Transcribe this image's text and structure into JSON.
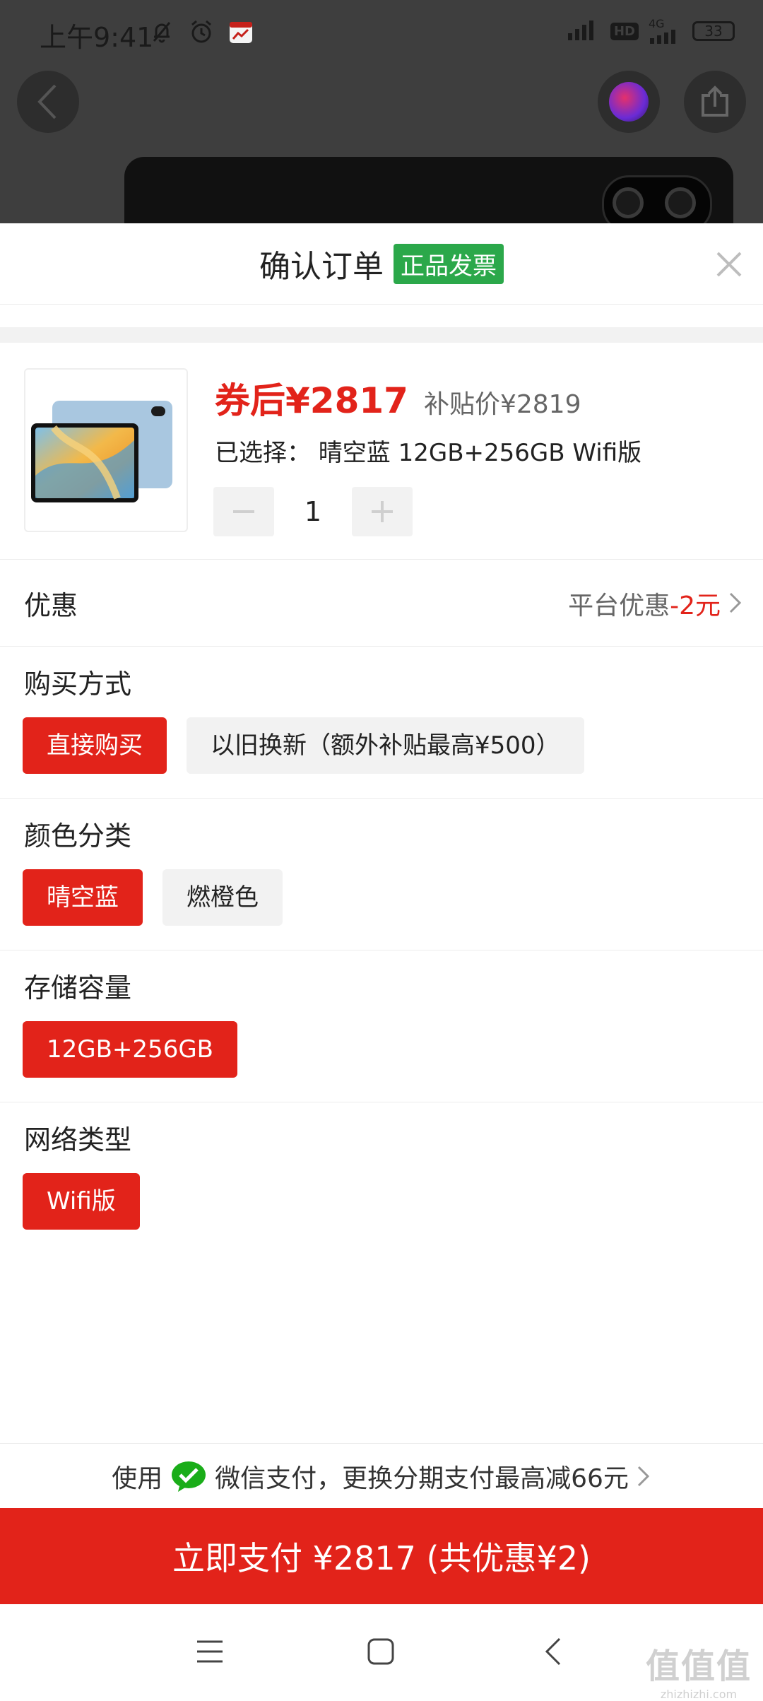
{
  "status_bar": {
    "time": "上午9:41",
    "icons": [
      "bell-off-icon",
      "alarm-icon",
      "calendar-app-icon"
    ],
    "network_badge": "HD",
    "network_type": "4G",
    "battery": "33"
  },
  "background_page": {
    "buttons": [
      "back-icon",
      "avatar",
      "share-icon"
    ]
  },
  "sheet": {
    "title": "确认订单",
    "badge": "正品发票"
  },
  "product": {
    "coupon_price": "券后¥2817",
    "subsidy_price": "补贴价¥2819",
    "selected": "已选择：  晴空蓝 12GB+256GB Wifi版",
    "quantity": "1"
  },
  "discount": {
    "label": "优惠",
    "value_prefix": "平台优惠",
    "value_amount": "-2元"
  },
  "sections": {
    "purchase": {
      "title": "购买方式",
      "options": [
        "直接购买",
        "以旧换新（额外补贴最高¥500）"
      ],
      "selected_index": 0
    },
    "color": {
      "title": "颜色分类",
      "options": [
        "晴空蓝",
        "燃橙色"
      ],
      "selected_index": 0
    },
    "storage": {
      "title": "存储容量",
      "options": [
        "12GB+256GB"
      ],
      "selected_index": 0
    },
    "network": {
      "title": "网络类型",
      "options": [
        "Wifi版"
      ],
      "selected_index": 0
    }
  },
  "payment": {
    "tip_prefix": "使用",
    "tip_text": "微信支付，更换分期支付最高减66元",
    "pay_button": "立即支付 ¥2817 (共优惠¥2)"
  },
  "nav_bar": {
    "items": [
      "menu-icon",
      "home-icon",
      "back-icon"
    ]
  },
  "watermark": {
    "main": "值值值",
    "sub": "zhizhizhi.com"
  },
  "colors": {
    "accent_red": "#e2231a",
    "invoice_green": "#2ba84a",
    "wechat_green": "#1aad19"
  }
}
